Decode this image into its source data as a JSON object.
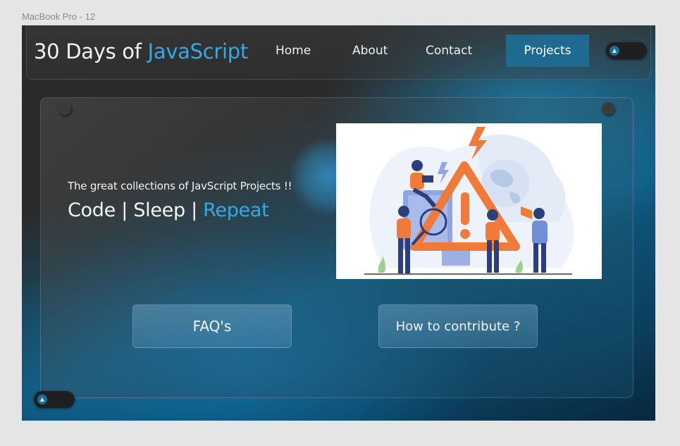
{
  "frame_label": "MacBook Pro - 12",
  "logo": {
    "prefix": "30 Days of ",
    "accent": "JavaScript"
  },
  "nav": {
    "home": "Home",
    "about": "About",
    "contact": "Contact",
    "projects": "Projects"
  },
  "hero": {
    "tagline": "The great collections of JavScript Projects !!",
    "headline_part1": "Code | Sleep | ",
    "headline_accent": "Repeat"
  },
  "buttons": {
    "faq": "FAQ's",
    "contribute": "How to contribute ?"
  },
  "colors": {
    "accent": "#35a8e6",
    "projects_button": "#1e6a91",
    "illustration_orange": "#f07a3a",
    "illustration_blue": "#2c3f7a"
  },
  "icons": {
    "theme_toggle": "toggle-icon",
    "scroll_toggle": "toggle-icon"
  }
}
